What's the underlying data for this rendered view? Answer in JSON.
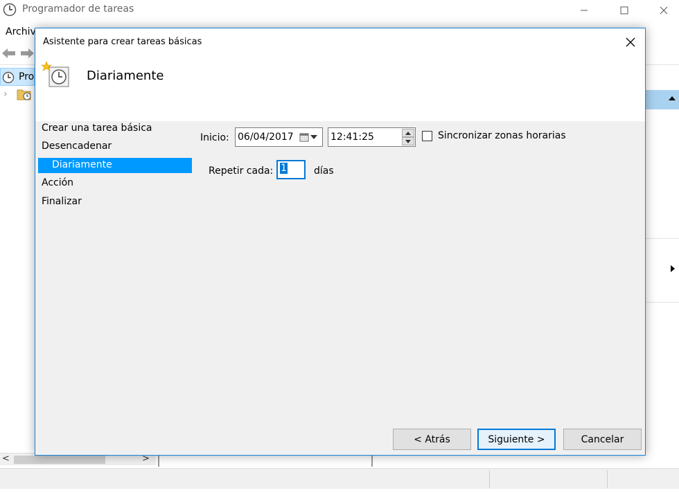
{
  "main_window": {
    "title": "Programador de tareas",
    "menu": {
      "archivo": "Archiv"
    },
    "tree": {
      "root_label": "Pro"
    }
  },
  "dialog": {
    "title": "Asistente para crear tareas básicas",
    "heading": "Diariamente",
    "steps": [
      {
        "label": "Crear una tarea básica"
      },
      {
        "label": "Desencadenar"
      },
      {
        "label": "Diariamente",
        "active": true
      },
      {
        "label": "Acción"
      },
      {
        "label": "Finalizar"
      }
    ],
    "form": {
      "inicio_label": "Inicio:",
      "date_value": "06/04/2017",
      "time_value": "12:41:25",
      "sync_label": "Sincronizar zonas horarias",
      "sync_checked": false,
      "repeat_label": "Repetir cada:",
      "repeat_value": "1",
      "repeat_unit": "días"
    },
    "buttons": {
      "back": "< Atrás",
      "next": "Siguiente >",
      "cancel": "Cancelar"
    }
  },
  "colors": {
    "accent": "#0078d7",
    "selection": "#0099ff",
    "dialog_border": "#1883d7",
    "dialog_bg": "#f0f0f0"
  }
}
